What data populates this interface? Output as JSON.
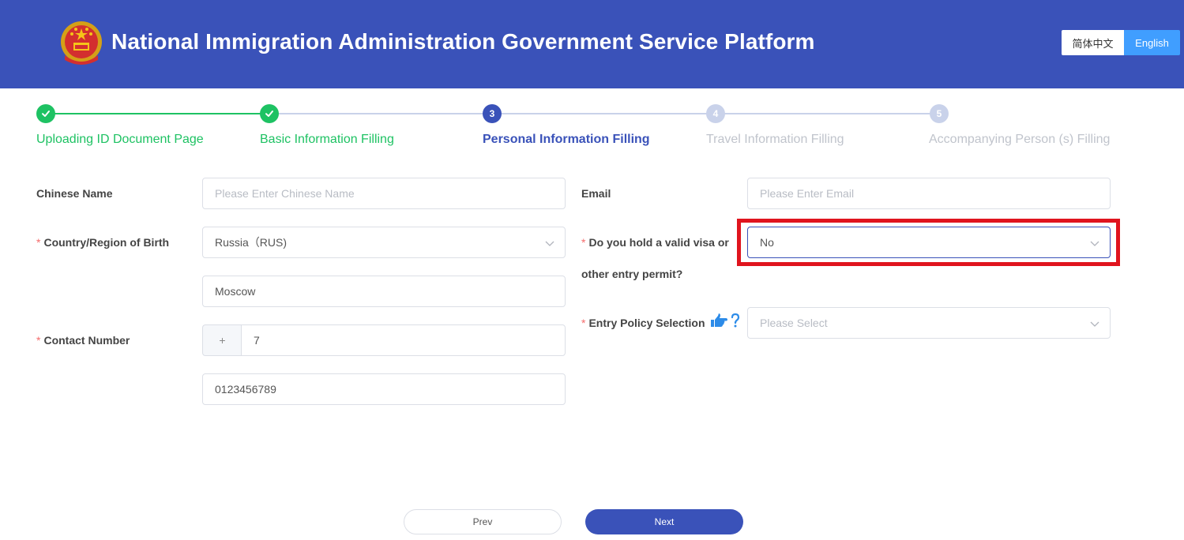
{
  "header": {
    "title": "National Immigration Administration Government Service Platform",
    "lang_zh": "简体中文",
    "lang_en": "English"
  },
  "steps": [
    {
      "label": "Uploading ID Document Page",
      "state": "done"
    },
    {
      "label": "Basic Information Filling",
      "state": "done"
    },
    {
      "label": "Personal Information Filling",
      "state": "active",
      "number": "3"
    },
    {
      "label": "Travel Information Filling",
      "state": "todo",
      "number": "4"
    },
    {
      "label": "Accompanying Person (s) Filling",
      "state": "todo",
      "number": "5"
    }
  ],
  "form": {
    "required_mark": "*",
    "chinese_name": {
      "label": "Chinese Name",
      "placeholder": "Please Enter Chinese Name"
    },
    "birth_country": {
      "label": "Country/Region of Birth",
      "value": "Russia（RUS)"
    },
    "birth_city": {
      "value": "Moscow"
    },
    "contact_number": {
      "label": "Contact Number",
      "prefix": "+",
      "code": "7",
      "number": "0123456789"
    },
    "email": {
      "label": "Email",
      "placeholder": "Please Enter Email"
    },
    "valid_visa": {
      "label_line1": "Do you hold a valid visa or",
      "label_line2": "other entry permit?",
      "value": "No"
    },
    "entry_policy": {
      "label": "Entry Policy Selection",
      "placeholder": "Please Select"
    }
  },
  "buttons": {
    "prev": "Prev",
    "next": "Next"
  },
  "colors": {
    "brand": "#3a52b9",
    "success": "#1ec263",
    "highlight": "#e0141e",
    "active_lang": "#409eff"
  }
}
